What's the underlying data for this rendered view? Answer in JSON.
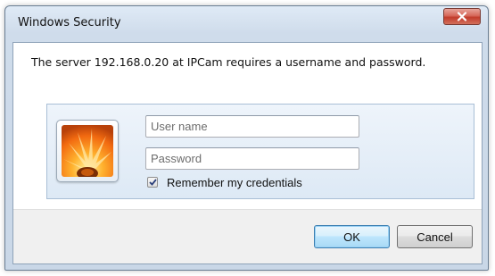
{
  "window": {
    "title": "Windows Security",
    "close_icon": "close-icon"
  },
  "message": "The server 192.168.0.20 at IPCam requires a username and password.",
  "credentials": {
    "avatar_icon": "user-tile-flower-icon",
    "username": {
      "value": "",
      "placeholder": "User name"
    },
    "password": {
      "value": "",
      "placeholder": "Password"
    },
    "remember": {
      "label": "Remember my credentials",
      "checked": true
    }
  },
  "buttons": {
    "ok_label": "OK",
    "cancel_label": "Cancel"
  },
  "colors": {
    "titlebar": "#cfdceb",
    "close_button": "#c9473a",
    "panel": "#dde9f5",
    "button_bar": "#f0f0f0",
    "ok_button_focus": "#3c7fb1"
  }
}
